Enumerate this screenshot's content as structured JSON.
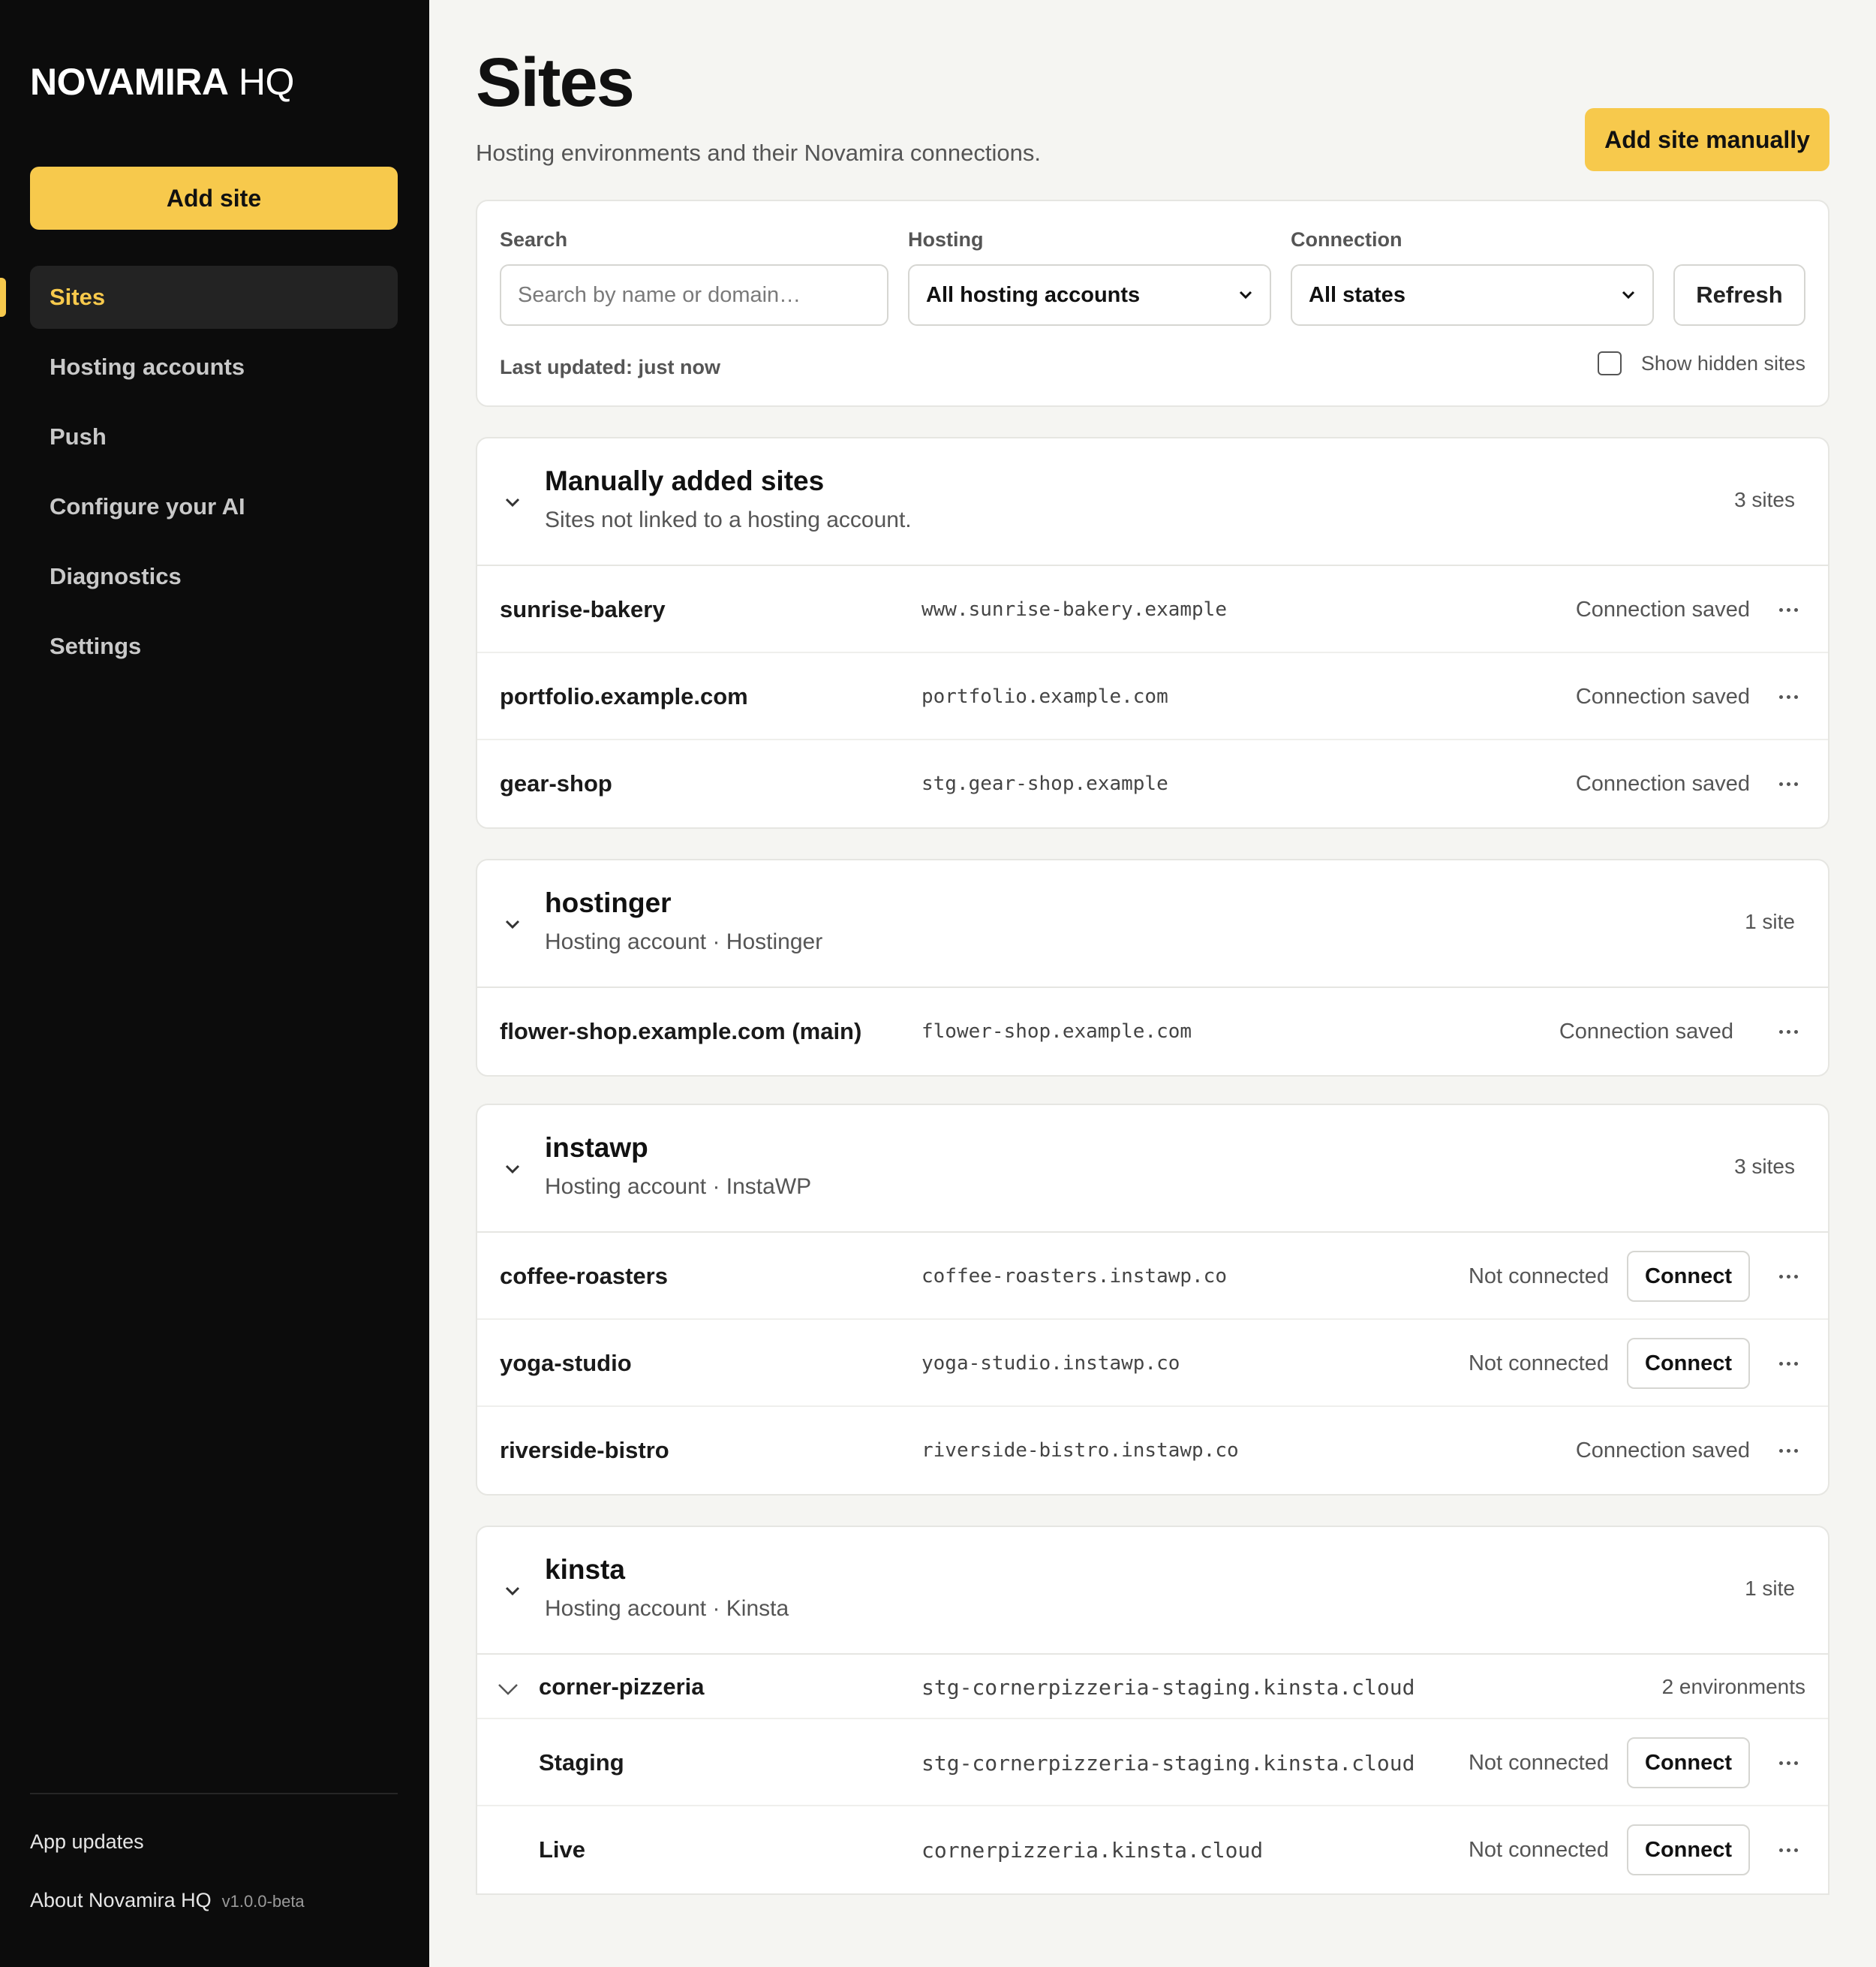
{
  "sidebar": {
    "brand_bold": "NOVAMIRA",
    "brand_light": "HQ",
    "add_site": "Add site",
    "nav": [
      {
        "label": "Sites",
        "active": true
      },
      {
        "label": "Hosting accounts"
      },
      {
        "label": "Push"
      },
      {
        "label": "Configure your AI"
      },
      {
        "label": "Diagnostics"
      },
      {
        "label": "Settings"
      }
    ],
    "app_updates": "App updates",
    "about": "About Novamira HQ",
    "version": "v1.0.0-beta"
  },
  "header": {
    "title": "Sites",
    "subtitle": "Hosting environments and their Novamira connections.",
    "add_manual": "Add site manually"
  },
  "filters": {
    "search_label": "Search",
    "search_placeholder": "Search by name or domain…",
    "hosting_label": "Hosting",
    "hosting_value": "All hosting accounts",
    "connection_label": "Connection",
    "connection_value": "All states",
    "refresh": "Refresh",
    "last_updated": "Last updated: just now",
    "show_hidden": "Show hidden sites"
  },
  "groups": [
    {
      "title": "Manually added sites",
      "subtitle": "Sites not linked to a hosting account.",
      "count": "3 sites",
      "rows": [
        {
          "name": "sunrise-bakery",
          "domain": "www.sunrise-bakery.example",
          "status": "Connection saved"
        },
        {
          "name": "portfolio.example.com",
          "domain": "portfolio.example.com",
          "status": "Connection saved"
        },
        {
          "name": "gear-shop",
          "domain": "stg.gear-shop.example",
          "status": "Connection saved"
        }
      ]
    },
    {
      "title": "hostinger",
      "subtitle": "Hosting account · Hostinger",
      "count": "1 site",
      "rows": [
        {
          "name": "flower-shop.example.com (main)",
          "domain": "flower-shop.example.com",
          "status": "Connection saved"
        }
      ]
    },
    {
      "title": "instawp",
      "subtitle": "Hosting account · InstaWP",
      "count": "3 sites",
      "rows": [
        {
          "name": "coffee-roasters",
          "domain": "coffee-roasters.instawp.co",
          "status": "Not connected",
          "action": "Connect"
        },
        {
          "name": "yoga-studio",
          "domain": "yoga-studio.instawp.co",
          "status": "Not connected",
          "action": "Connect"
        },
        {
          "name": "riverside-bistro",
          "domain": "riverside-bistro.instawp.co",
          "status": "Connection saved"
        }
      ]
    },
    {
      "title": "kinsta",
      "subtitle": "Hosting account · Kinsta",
      "count": "1 site",
      "site": {
        "name": "corner-pizzeria",
        "domain": "stg-cornerpizzeria-staging.kinsta.cloud",
        "env_count": "2 environments"
      },
      "rows": [
        {
          "name": "Staging",
          "domain": "stg-cornerpizzeria-staging.kinsta.cloud",
          "status": "Not connected",
          "action": "Connect"
        },
        {
          "name": "Live",
          "domain": "cornerpizzeria.kinsta.cloud",
          "status": "Not connected",
          "action": "Connect"
        }
      ]
    }
  ]
}
